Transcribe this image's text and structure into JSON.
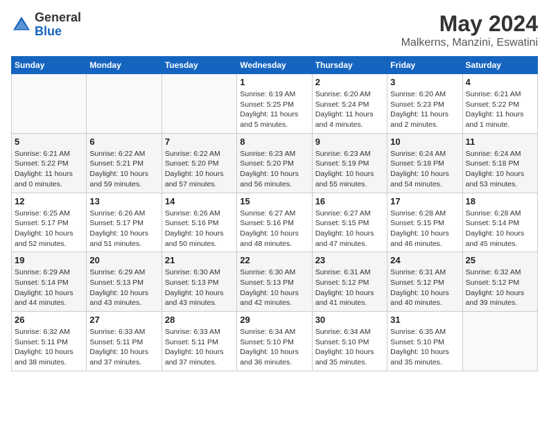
{
  "header": {
    "logo": {
      "general": "General",
      "blue": "Blue"
    },
    "title": "May 2024",
    "location": "Malkerns, Manzini, Eswatini"
  },
  "weekdays": [
    "Sunday",
    "Monday",
    "Tuesday",
    "Wednesday",
    "Thursday",
    "Friday",
    "Saturday"
  ],
  "weeks": [
    [
      {
        "day": "",
        "sunrise": "",
        "sunset": "",
        "daylight": ""
      },
      {
        "day": "",
        "sunrise": "",
        "sunset": "",
        "daylight": ""
      },
      {
        "day": "",
        "sunrise": "",
        "sunset": "",
        "daylight": ""
      },
      {
        "day": "1",
        "sunrise": "Sunrise: 6:19 AM",
        "sunset": "Sunset: 5:25 PM",
        "daylight": "Daylight: 11 hours and 5 minutes."
      },
      {
        "day": "2",
        "sunrise": "Sunrise: 6:20 AM",
        "sunset": "Sunset: 5:24 PM",
        "daylight": "Daylight: 11 hours and 4 minutes."
      },
      {
        "day": "3",
        "sunrise": "Sunrise: 6:20 AM",
        "sunset": "Sunset: 5:23 PM",
        "daylight": "Daylight: 11 hours and 2 minutes."
      },
      {
        "day": "4",
        "sunrise": "Sunrise: 6:21 AM",
        "sunset": "Sunset: 5:22 PM",
        "daylight": "Daylight: 11 hours and 1 minute."
      }
    ],
    [
      {
        "day": "5",
        "sunrise": "Sunrise: 6:21 AM",
        "sunset": "Sunset: 5:22 PM",
        "daylight": "Daylight: 11 hours and 0 minutes."
      },
      {
        "day": "6",
        "sunrise": "Sunrise: 6:22 AM",
        "sunset": "Sunset: 5:21 PM",
        "daylight": "Daylight: 10 hours and 59 minutes."
      },
      {
        "day": "7",
        "sunrise": "Sunrise: 6:22 AM",
        "sunset": "Sunset: 5:20 PM",
        "daylight": "Daylight: 10 hours and 57 minutes."
      },
      {
        "day": "8",
        "sunrise": "Sunrise: 6:23 AM",
        "sunset": "Sunset: 5:20 PM",
        "daylight": "Daylight: 10 hours and 56 minutes."
      },
      {
        "day": "9",
        "sunrise": "Sunrise: 6:23 AM",
        "sunset": "Sunset: 5:19 PM",
        "daylight": "Daylight: 10 hours and 55 minutes."
      },
      {
        "day": "10",
        "sunrise": "Sunrise: 6:24 AM",
        "sunset": "Sunset: 5:18 PM",
        "daylight": "Daylight: 10 hours and 54 minutes."
      },
      {
        "day": "11",
        "sunrise": "Sunrise: 6:24 AM",
        "sunset": "Sunset: 5:18 PM",
        "daylight": "Daylight: 10 hours and 53 minutes."
      }
    ],
    [
      {
        "day": "12",
        "sunrise": "Sunrise: 6:25 AM",
        "sunset": "Sunset: 5:17 PM",
        "daylight": "Daylight: 10 hours and 52 minutes."
      },
      {
        "day": "13",
        "sunrise": "Sunrise: 6:26 AM",
        "sunset": "Sunset: 5:17 PM",
        "daylight": "Daylight: 10 hours and 51 minutes."
      },
      {
        "day": "14",
        "sunrise": "Sunrise: 6:26 AM",
        "sunset": "Sunset: 5:16 PM",
        "daylight": "Daylight: 10 hours and 50 minutes."
      },
      {
        "day": "15",
        "sunrise": "Sunrise: 6:27 AM",
        "sunset": "Sunset: 5:16 PM",
        "daylight": "Daylight: 10 hours and 48 minutes."
      },
      {
        "day": "16",
        "sunrise": "Sunrise: 6:27 AM",
        "sunset": "Sunset: 5:15 PM",
        "daylight": "Daylight: 10 hours and 47 minutes."
      },
      {
        "day": "17",
        "sunrise": "Sunrise: 6:28 AM",
        "sunset": "Sunset: 5:15 PM",
        "daylight": "Daylight: 10 hours and 46 minutes."
      },
      {
        "day": "18",
        "sunrise": "Sunrise: 6:28 AM",
        "sunset": "Sunset: 5:14 PM",
        "daylight": "Daylight: 10 hours and 45 minutes."
      }
    ],
    [
      {
        "day": "19",
        "sunrise": "Sunrise: 6:29 AM",
        "sunset": "Sunset: 5:14 PM",
        "daylight": "Daylight: 10 hours and 44 minutes."
      },
      {
        "day": "20",
        "sunrise": "Sunrise: 6:29 AM",
        "sunset": "Sunset: 5:13 PM",
        "daylight": "Daylight: 10 hours and 43 minutes."
      },
      {
        "day": "21",
        "sunrise": "Sunrise: 6:30 AM",
        "sunset": "Sunset: 5:13 PM",
        "daylight": "Daylight: 10 hours and 43 minutes."
      },
      {
        "day": "22",
        "sunrise": "Sunrise: 6:30 AM",
        "sunset": "Sunset: 5:13 PM",
        "daylight": "Daylight: 10 hours and 42 minutes."
      },
      {
        "day": "23",
        "sunrise": "Sunrise: 6:31 AM",
        "sunset": "Sunset: 5:12 PM",
        "daylight": "Daylight: 10 hours and 41 minutes."
      },
      {
        "day": "24",
        "sunrise": "Sunrise: 6:31 AM",
        "sunset": "Sunset: 5:12 PM",
        "daylight": "Daylight: 10 hours and 40 minutes."
      },
      {
        "day": "25",
        "sunrise": "Sunrise: 6:32 AM",
        "sunset": "Sunset: 5:12 PM",
        "daylight": "Daylight: 10 hours and 39 minutes."
      }
    ],
    [
      {
        "day": "26",
        "sunrise": "Sunrise: 6:32 AM",
        "sunset": "Sunset: 5:11 PM",
        "daylight": "Daylight: 10 hours and 38 minutes."
      },
      {
        "day": "27",
        "sunrise": "Sunrise: 6:33 AM",
        "sunset": "Sunset: 5:11 PM",
        "daylight": "Daylight: 10 hours and 37 minutes."
      },
      {
        "day": "28",
        "sunrise": "Sunrise: 6:33 AM",
        "sunset": "Sunset: 5:11 PM",
        "daylight": "Daylight: 10 hours and 37 minutes."
      },
      {
        "day": "29",
        "sunrise": "Sunrise: 6:34 AM",
        "sunset": "Sunset: 5:10 PM",
        "daylight": "Daylight: 10 hours and 36 minutes."
      },
      {
        "day": "30",
        "sunrise": "Sunrise: 6:34 AM",
        "sunset": "Sunset: 5:10 PM",
        "daylight": "Daylight: 10 hours and 35 minutes."
      },
      {
        "day": "31",
        "sunrise": "Sunrise: 6:35 AM",
        "sunset": "Sunset: 5:10 PM",
        "daylight": "Daylight: 10 hours and 35 minutes."
      },
      {
        "day": "",
        "sunrise": "",
        "sunset": "",
        "daylight": ""
      }
    ]
  ]
}
